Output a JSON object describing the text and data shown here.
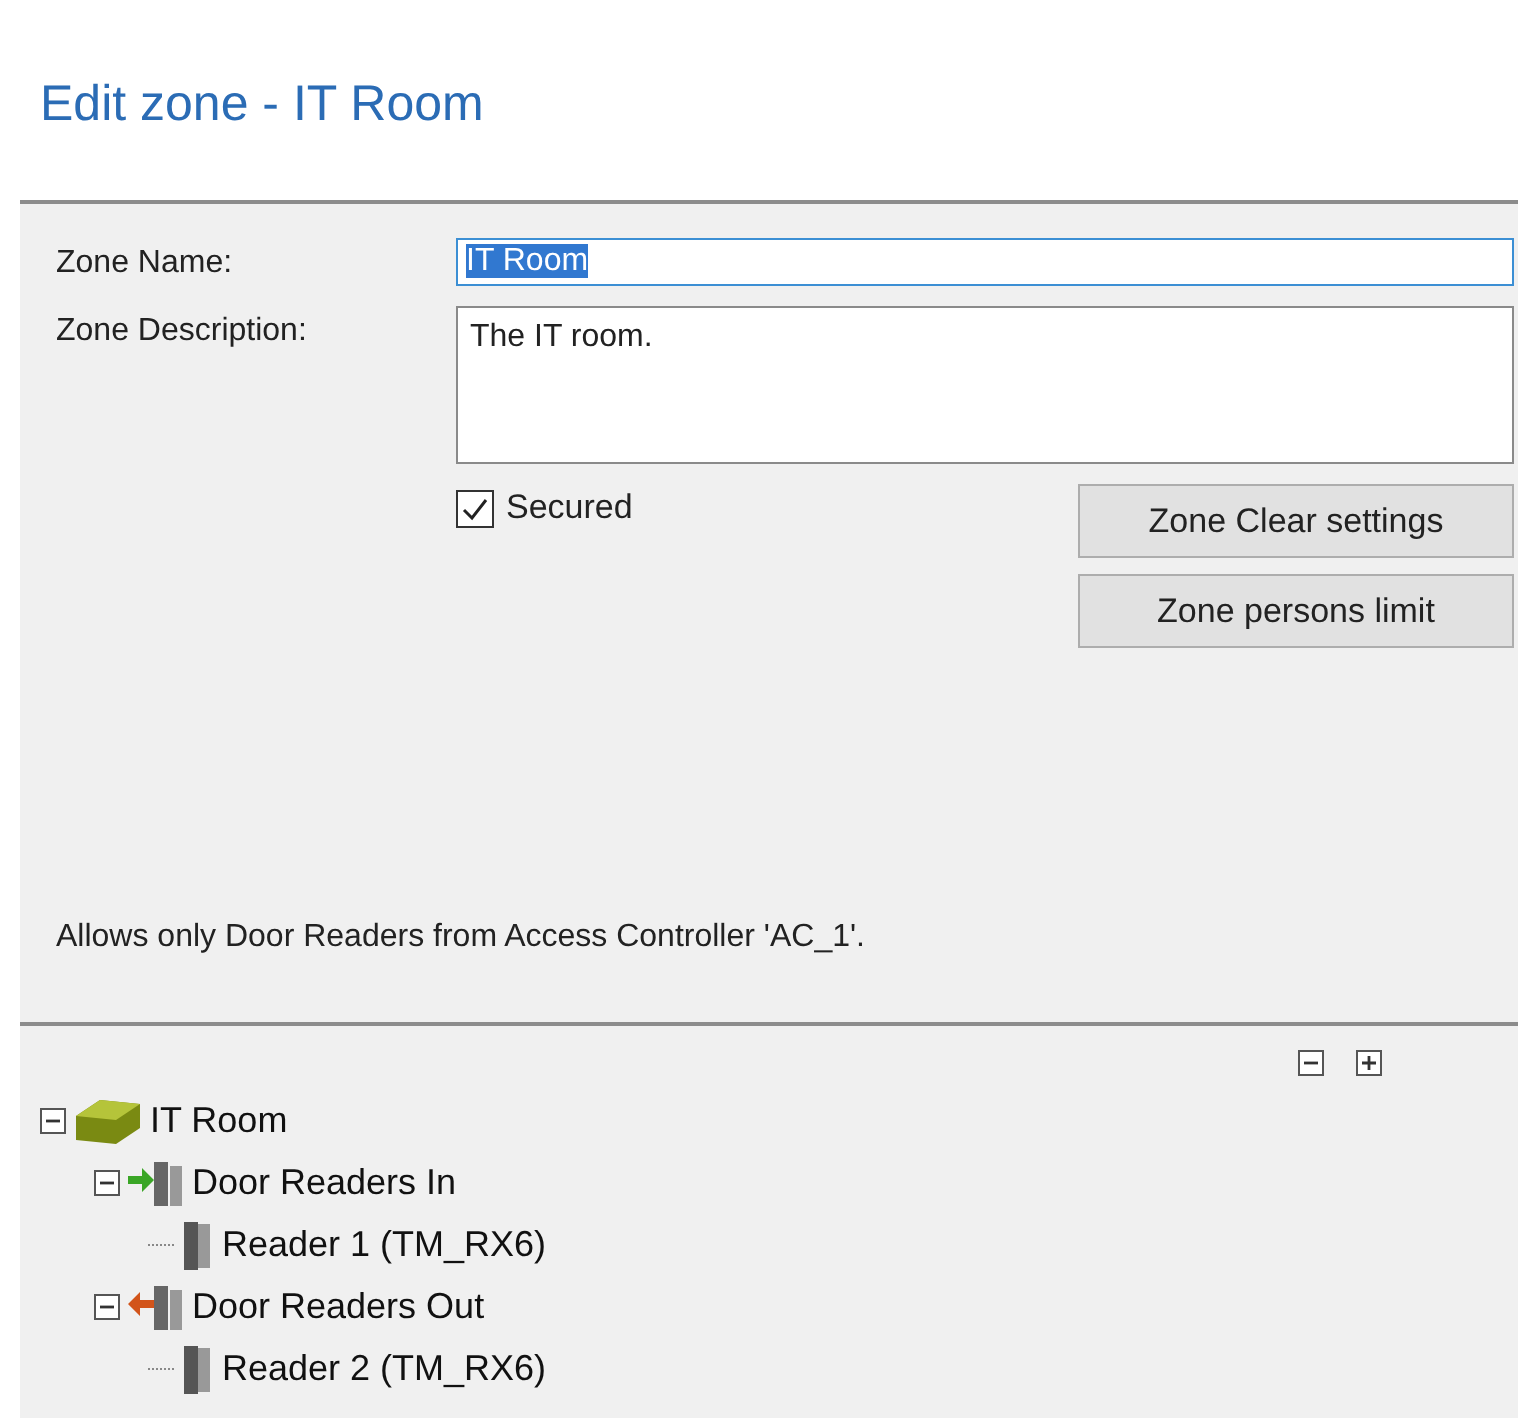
{
  "title": "Edit zone - IT Room",
  "form": {
    "name_label": "Zone Name:",
    "name_value": "IT Room",
    "name_selected": true,
    "description_label": "Zone Description:",
    "description_value": "The IT room.",
    "secured": {
      "label": "Secured",
      "checked": true
    }
  },
  "buttons": [
    "Zone Clear settings",
    "Zone persons limit"
  ],
  "note": "Allows only Door Readers from Access Controller 'AC_1'.",
  "tree": [
    {
      "label": "IT Room",
      "kind": "zone",
      "expanded": true,
      "children": [
        {
          "label": "Door Readers In",
          "kind": "readers-in",
          "expanded": true,
          "children": [
            {
              "label": "Reader 1 (TM_RX6)",
              "kind": "reader"
            }
          ]
        },
        {
          "label": "Door Readers Out",
          "kind": "readers-out",
          "expanded": true,
          "children": [
            {
              "label": "Reader 2 (TM_RX6)",
              "kind": "reader"
            }
          ]
        }
      ]
    }
  ]
}
